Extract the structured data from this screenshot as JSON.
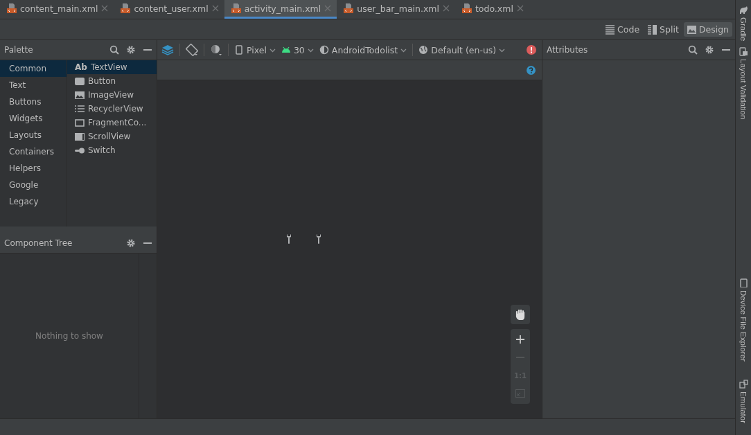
{
  "tabs": [
    {
      "label": "content_main.xml",
      "selected": false
    },
    {
      "label": "content_user.xml",
      "selected": false
    },
    {
      "label": "activity_main.xml",
      "selected": true
    },
    {
      "label": "user_bar_main.xml",
      "selected": false
    },
    {
      "label": "todo.xml",
      "selected": false
    }
  ],
  "view_modes": [
    {
      "label": "Code",
      "kind": "code",
      "selected": false
    },
    {
      "label": "Split",
      "kind": "split",
      "selected": false
    },
    {
      "label": "Design",
      "kind": "design",
      "selected": true
    }
  ],
  "palette": {
    "title": "Palette",
    "categories": [
      {
        "label": "Common",
        "selected": true
      },
      {
        "label": "Text",
        "selected": false
      },
      {
        "label": "Buttons",
        "selected": false
      },
      {
        "label": "Widgets",
        "selected": false
      },
      {
        "label": "Layouts",
        "selected": false
      },
      {
        "label": "Containers",
        "selected": false
      },
      {
        "label": "Helpers",
        "selected": false
      },
      {
        "label": "Google",
        "selected": false
      },
      {
        "label": "Legacy",
        "selected": false
      }
    ],
    "widgets": [
      {
        "label": "TextView",
        "kind": "text",
        "glyph": "Ab",
        "selected": true
      },
      {
        "label": "Button",
        "kind": "button",
        "selected": false
      },
      {
        "label": "ImageView",
        "kind": "image",
        "selected": false
      },
      {
        "label": "RecyclerView",
        "kind": "list",
        "selected": false
      },
      {
        "label": "FragmentCo...",
        "kind": "frame",
        "selected": false
      },
      {
        "label": "ScrollView",
        "kind": "scroll",
        "selected": false
      },
      {
        "label": "Switch",
        "kind": "switch",
        "selected": false
      }
    ]
  },
  "component_tree": {
    "title": "Component Tree",
    "empty_text": "Nothing to show"
  },
  "toolbar": {
    "device": "Pixel",
    "api": "30",
    "theme": "AndroidTodolist",
    "locale": "Default (en-us)"
  },
  "attributes": {
    "title": "Attributes"
  },
  "zoom_controls": {
    "reset_label": "1:1",
    "zoom_out_disabled": true
  },
  "side_tools": [
    "Gradle",
    "Layout Validation",
    "Device File Explorer",
    "Emulator"
  ]
}
